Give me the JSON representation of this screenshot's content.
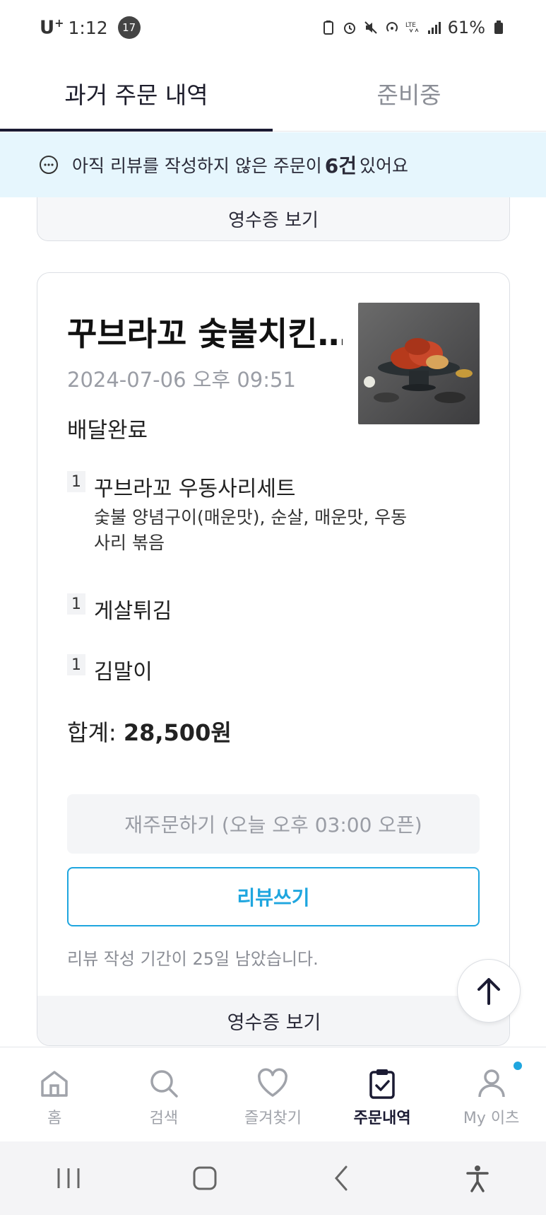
{
  "status_bar": {
    "carrier": "U",
    "carrier_plus": "+",
    "time": "1:12",
    "notification_count": "17",
    "battery": "61%"
  },
  "tabs": [
    {
      "label": "과거 주문 내역",
      "active": true
    },
    {
      "label": "준비중",
      "active": false
    }
  ],
  "banner": {
    "text_before": "아직 리뷰를 작성하지 않은 주문이",
    "count": "6건",
    "text_after": "있어요"
  },
  "prev_order": {
    "receipt_label": "영수증 보기"
  },
  "order": {
    "store_name": "꾸브라꼬 숯불치킨…",
    "date": "2024-07-06 오후 09:51",
    "status": "배달완료",
    "items": [
      {
        "qty": "1",
        "name": "꾸브라꼬 우동사리세트",
        "options": "숯불 양념구이(매운맛), 순살, 매운맛, 우동사리 볶음"
      },
      {
        "qty": "1",
        "name": "게살튀김",
        "options": ""
      },
      {
        "qty": "1",
        "name": "김말이",
        "options": ""
      }
    ],
    "total_label": "합계:",
    "total_amount": "28,500원",
    "reorder_label": "재주문하기 (오늘 오후 03:00 오픈)",
    "review_label": "리뷰쓰기",
    "review_period": "리뷰 작성 기간이 25일 남았습니다.",
    "receipt_label": "영수증 보기"
  },
  "bottom_nav": [
    {
      "label": "홈",
      "icon": "home-icon",
      "active": false
    },
    {
      "label": "검색",
      "icon": "search-icon",
      "active": false
    },
    {
      "label": "즐겨찾기",
      "icon": "heart-icon",
      "active": false
    },
    {
      "label": "주문내역",
      "icon": "clipboard-check-icon",
      "active": true
    },
    {
      "label": "My 이츠",
      "icon": "person-icon",
      "active": false
    }
  ],
  "colors": {
    "accent": "#1fa6df",
    "banner_bg": "#e6f6fd",
    "dark": "#1b1b33"
  }
}
